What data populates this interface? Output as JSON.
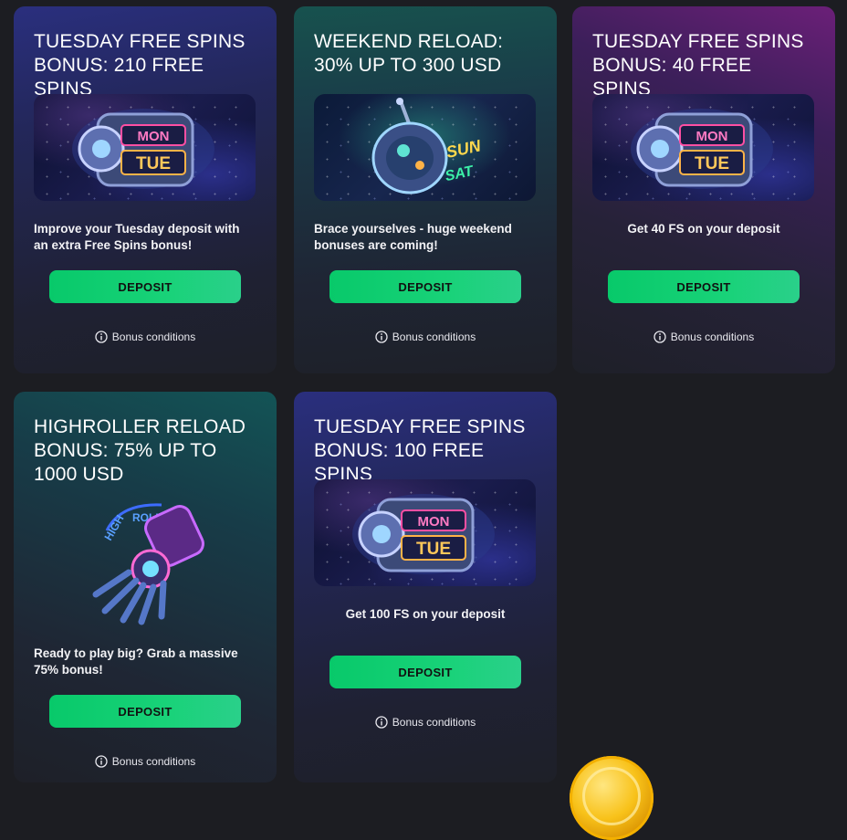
{
  "bonuses": [
    {
      "title": "TUESDAY FREE SPINS BONUS: 210 FREE SPINS",
      "description": "Improve your Tuesday deposit with an extra Free Spins bonus!",
      "image": "monday-tuesday-slot-machine-illustration",
      "button_label": "DEPOSIT",
      "conditions_label": "Bonus conditions"
    },
    {
      "title": "WEEKEND RELOAD: 30% UP TO 300 USD",
      "description": "Brace yourselves - huge weekend bonuses are coming!",
      "image": "sun-sat-robot-illustration",
      "button_label": "DEPOSIT",
      "conditions_label": "Bonus conditions"
    },
    {
      "title": "TUESDAY FREE SPINS BONUS: 40 FREE SPINS",
      "description": "Get 40 FS on your deposit",
      "image": "monday-tuesday-slot-machine-illustration",
      "button_label": "DEPOSIT",
      "conditions_label": "Bonus conditions"
    },
    {
      "title": "HIGHROLLER RELOAD BONUS: 75% UP TO 1000 USD",
      "description": "Ready to play big? Grab a massive 75% bonus!",
      "image": "high-roller-robotic-hand-illustration",
      "button_label": "DEPOSIT",
      "conditions_label": "Bonus conditions"
    },
    {
      "title": "TUESDAY FREE SPINS BONUS: 100 FREE SPINS",
      "description": "Get 100 FS on your deposit",
      "image": "monday-tuesday-slot-machine-illustration",
      "button_label": "DEPOSIT",
      "conditions_label": "Bonus conditions"
    }
  ],
  "banner_text": {
    "mon": "MON",
    "tue": "TUE",
    "sun": "SUN",
    "sat": "SAT",
    "high": "HIGH",
    "roller": "ROLLER"
  },
  "colors": {
    "background": "#1c1d22",
    "button_green": "#08c96a",
    "button_text": "#111111",
    "coin": "#f8c21a"
  }
}
